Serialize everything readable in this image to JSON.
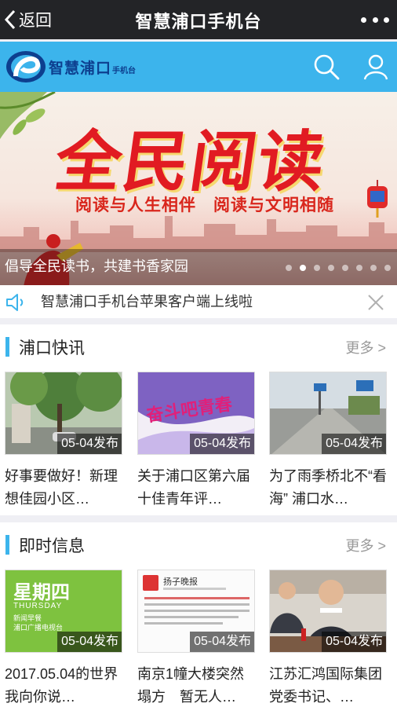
{
  "navbar": {
    "back_label": "返回",
    "title": "智慧浦口手机台"
  },
  "header": {
    "logo_text": "智慧浦口",
    "logo_sub": "手机台",
    "accent": "#3cb4ec"
  },
  "banner": {
    "title": "全民阅读",
    "subtitle_left": "阅读与人生相伴",
    "subtitle_right": "阅读与文明相随",
    "caption": "倡导全民读书，共建书香家园",
    "slide_count": 8,
    "active_slide": 2
  },
  "notice": {
    "text": "智慧浦口手机台苹果客户端上线啦"
  },
  "sections": [
    {
      "title": "浦口快讯",
      "more": "更多 >",
      "items": [
        {
          "date": "05-04发布",
          "title": "好事要做好！新理想佳园小区…"
        },
        {
          "date": "05-04发布",
          "title": "关于浦口区第六届十佳青年评…",
          "thumb_text": "奋斗吧青春"
        },
        {
          "date": "05-04发布",
          "title": "为了雨季桥北不“看海” 浦口水…"
        }
      ]
    },
    {
      "title": "即时信息",
      "more": "更多 >",
      "items": [
        {
          "date": "05-04发布",
          "title": "2017.05.04的世界　我向你说…",
          "thumb_text": "星期四",
          "thumb_sub": "THURSDAY",
          "thumb_sub2": "新闻早餐",
          "thumb_sub3": "浦口广播电视台"
        },
        {
          "date": "05-04发布",
          "title": "南京1幢大楼突然塌方　暂无人…",
          "thumb_text": "扬子晚报"
        },
        {
          "date": "05-04发布",
          "title": "江苏汇鸿国际集团党委书记、…"
        }
      ]
    }
  ]
}
